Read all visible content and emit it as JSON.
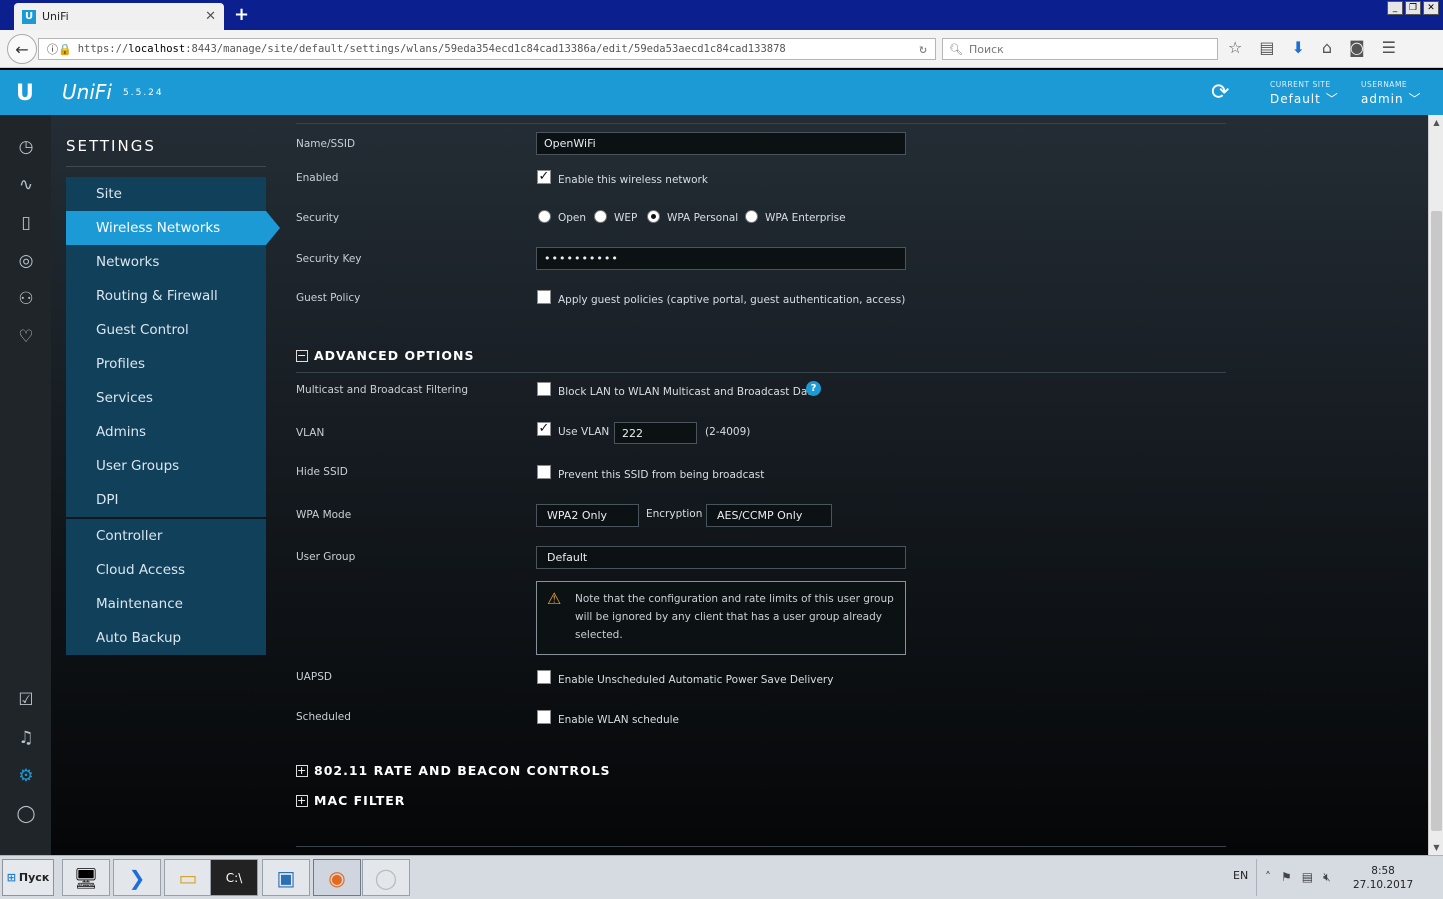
{
  "browser": {
    "tab_title": "UniFi",
    "tab_favicon": "U",
    "url_protocol": "https://",
    "url_host": "localhost",
    "url_rest": ":8443/manage/site/default/settings/wlans/59eda354ecd1c84cad13386a/edit/59eda53aecd1c84cad133878",
    "search_placeholder": "Поиск"
  },
  "header": {
    "logo": "U",
    "brand": "UniFi",
    "version": "5.5.24",
    "current_site_label": "CURRENT SITE",
    "current_site_value": "Default",
    "username_label": "USERNAME",
    "username_value": "admin"
  },
  "sidebar": {
    "title": "SETTINGS",
    "items": [
      {
        "label": "Site"
      },
      {
        "label": "Wireless Networks"
      },
      {
        "label": "Networks"
      },
      {
        "label": "Routing & Firewall"
      },
      {
        "label": "Guest Control"
      },
      {
        "label": "Profiles"
      },
      {
        "label": "Services"
      },
      {
        "label": "Admins"
      },
      {
        "label": "User Groups"
      },
      {
        "label": "DPI"
      },
      {
        "label": "Controller"
      },
      {
        "label": "Cloud Access"
      },
      {
        "label": "Maintenance"
      },
      {
        "label": "Auto Backup"
      }
    ],
    "selected": "Wireless Networks"
  },
  "form": {
    "name_label": "Name/SSID",
    "name_value": "OpenWiFi",
    "enabled_label": "Enabled",
    "enabled_text": "Enable this wireless network",
    "security_label": "Security",
    "security_options": [
      "Open",
      "WEP",
      "WPA Personal",
      "WPA Enterprise"
    ],
    "security_selected": "WPA Personal",
    "key_label": "Security Key",
    "key_value": "••••••••••",
    "guest_label": "Guest Policy",
    "guest_text": "Apply guest policies (captive portal, guest authentication, access)",
    "advanced_title": "ADVANCED OPTIONS",
    "multicast_label": "Multicast and Broadcast Filtering",
    "multicast_text": "Block LAN to WLAN Multicast and Broadcast Data",
    "help_mark": "?",
    "vlan_label": "VLAN",
    "vlan_text": "Use VLAN",
    "vlan_value": "222",
    "vlan_range": "(2-4009)",
    "hide_label": "Hide SSID",
    "hide_text": "Prevent this SSID from being broadcast",
    "wpa_label": "WPA Mode",
    "wpa_value": "WPA2 Only",
    "enc_label": "Encryption",
    "enc_value": "AES/CCMP Only",
    "usergroup_label": "User Group",
    "usergroup_value": "Default",
    "note": "Note that the configuration and rate limits of this user group will be ignored by any client that has a user group already selected.",
    "uapsd_label": "UAPSD",
    "uapsd_text": "Enable Unscheduled Automatic Power Save Delivery",
    "sched_label": "Scheduled",
    "sched_text": "Enable WLAN schedule",
    "rate_title": "802.11 RATE AND BEACON CONTROLS",
    "mac_title": "MAC FILTER"
  },
  "checkbox_states": {
    "enabled": true,
    "guest": false,
    "multicast": false,
    "vlan": true,
    "hide": false,
    "uapsd": false,
    "scheduled": false
  },
  "taskbar": {
    "start_label": "Пуск",
    "lang": "EN",
    "time": "8:58",
    "date": "27.10.2017"
  },
  "colors": {
    "accent": "#1c9ad6",
    "nav_bg": "#11405b",
    "titlebar": "#0b1f8f"
  }
}
